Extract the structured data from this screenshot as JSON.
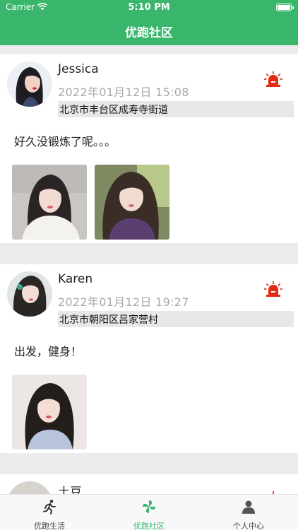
{
  "status_bar": {
    "carrier": "Carrier",
    "time": "5:10 PM"
  },
  "nav": {
    "title": "优跑社区"
  },
  "posts": [
    {
      "username": "Jessica",
      "time": "2022年01月12日  15:08",
      "location": "北京市丰台区成寿寺街道",
      "content": "好久没锻炼了呢。。。",
      "photo_count": 2
    },
    {
      "username": "Karen",
      "time": "2022年01月12日  19:27",
      "location": "北京市朝阳区吕家营村",
      "content": "出发，健身！",
      "photo_count": 1
    },
    {
      "username": "土豆"
    }
  ],
  "tabbar": {
    "items": [
      {
        "label": "优跑生活"
      },
      {
        "label": "优跑社区"
      },
      {
        "label": "个人中心"
      }
    ]
  },
  "colors": {
    "brand_green": "#39b66b",
    "alert_red": "#e12b14"
  }
}
